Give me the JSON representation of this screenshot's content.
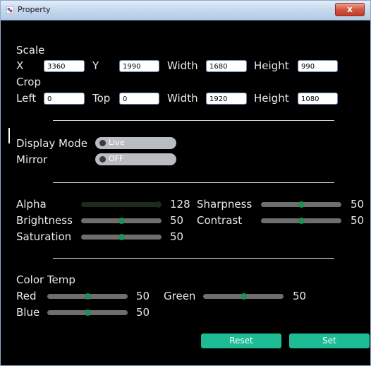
{
  "window": {
    "title": "Property",
    "close_label": "x"
  },
  "scale": {
    "heading": "Scale",
    "x_label": "X",
    "x_value": "3360",
    "y_label": "Y",
    "y_value": "1990",
    "width_label": "Width",
    "width_value": "1680",
    "height_label": "Height",
    "height_value": "990"
  },
  "crop": {
    "heading": "Crop",
    "left_label": "Left",
    "left_value": "0",
    "top_label": "Top",
    "top_value": "0",
    "width_label": "Width",
    "width_value": "1920",
    "height_label": "Height",
    "height_value": "1080"
  },
  "display": {
    "mode_label": "Display Mode",
    "mode_value": "Live",
    "mirror_label": "Mirror",
    "mirror_value": "OFF"
  },
  "image": {
    "alpha": {
      "label": "Alpha",
      "value": 128,
      "fraction": 1.0
    },
    "sharpness": {
      "label": "Sharpness",
      "value": 50,
      "fraction": 0.5
    },
    "brightness": {
      "label": "Brightness",
      "value": 50,
      "fraction": 0.5
    },
    "contrast": {
      "label": "Contrast",
      "value": 50,
      "fraction": 0.5
    },
    "saturation": {
      "label": "Saturation",
      "value": 50,
      "fraction": 0.5
    }
  },
  "color_temp": {
    "heading": "Color Temp",
    "red": {
      "label": "Red",
      "value": 50,
      "fraction": 0.5
    },
    "green": {
      "label": "Green",
      "value": 50,
      "fraction": 0.5
    },
    "blue": {
      "label": "Blue",
      "value": 50,
      "fraction": 0.5
    }
  },
  "buttons": {
    "reset_label": "Reset",
    "set_label": "Set"
  },
  "colors": {
    "window_bg": "#000000",
    "text": "#eaeaea",
    "accent": "#1ebc94",
    "slider_track": "#6e6e6e",
    "slider_thumb": "#1f8f5c",
    "toggle_bg": "#b9bcc0"
  }
}
